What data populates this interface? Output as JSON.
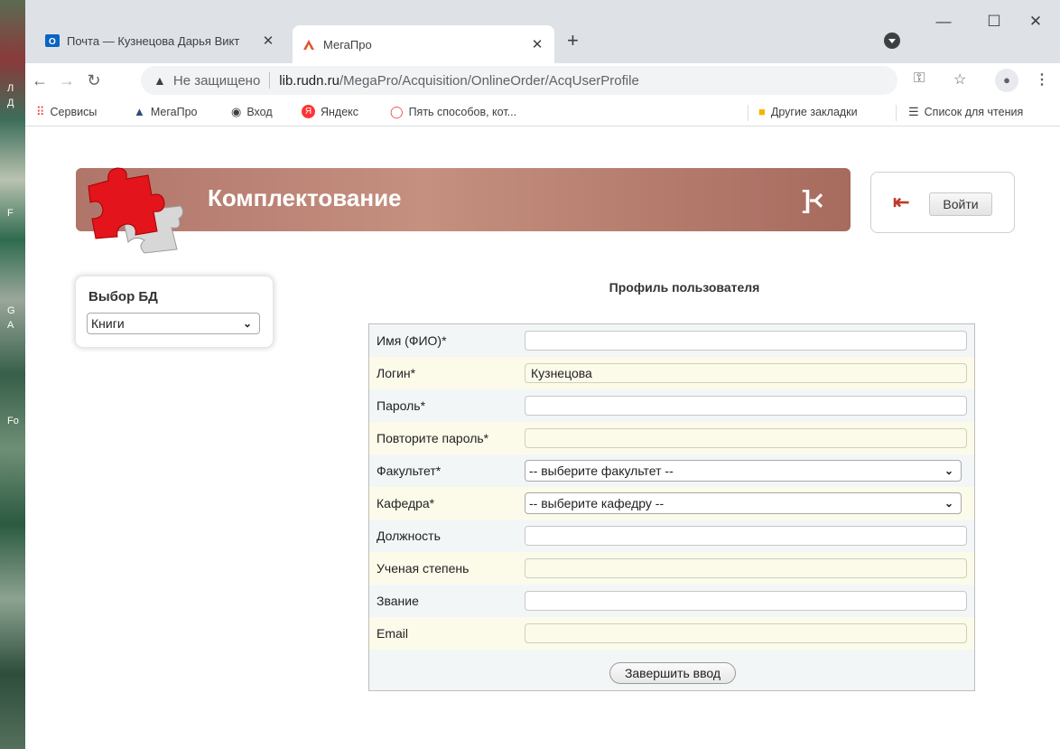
{
  "desktop": {
    "fragments": [
      "Л",
      "Д",
      "F",
      "G",
      "A",
      "Fo"
    ]
  },
  "browser": {
    "tabs": [
      {
        "title": "Почта — Кузнецова Дарья Викт",
        "active": false
      },
      {
        "title": "МегаПро",
        "active": true
      }
    ],
    "new_tab": "+",
    "window_controls": {
      "minimize": "—",
      "maximize": "☐",
      "close": "✕"
    },
    "address": {
      "security_label": "Не защищено",
      "host": "lib.rudn.ru",
      "path": "/MegaPro/Acquisition/OnlineOrder/AcqUserProfile"
    },
    "bookmarks": [
      {
        "label": "Сервисы",
        "icon": "apps-grid-icon"
      },
      {
        "label": "МегаПро",
        "icon": "megapro-icon"
      },
      {
        "label": "Вход",
        "icon": "globe-icon"
      },
      {
        "label": "Яндекс",
        "icon": "yandex-icon"
      },
      {
        "label": "Пять способов, кот...",
        "icon": "speech-bubble-icon"
      }
    ],
    "bookmarks_right": [
      {
        "label": "Другие закладки",
        "icon": "folder-icon"
      },
      {
        "label": "Список для чтения",
        "icon": "reading-list-icon"
      }
    ]
  },
  "page": {
    "banner_title": "Комплектование",
    "login_button": "Войти",
    "db_panel": {
      "label": "Выбор БД",
      "selected": "Книги"
    },
    "profile_heading": "Профиль пользователя",
    "fields": [
      {
        "label": "Имя (ФИО)*",
        "type": "text",
        "value": ""
      },
      {
        "label": "Логин*",
        "type": "text",
        "value": "Кузнецова"
      },
      {
        "label": "Пароль*",
        "type": "text",
        "value": ""
      },
      {
        "label": "Повторите пароль*",
        "type": "text",
        "value": ""
      },
      {
        "label": "Факультет*",
        "type": "select",
        "value": "-- выберите факультет --"
      },
      {
        "label": "Кафедра*",
        "type": "select",
        "value": "-- выберите кафедру --"
      },
      {
        "label": "Должность",
        "type": "text",
        "value": ""
      },
      {
        "label": "Ученая степень",
        "type": "text",
        "value": ""
      },
      {
        "label": "Звание",
        "type": "text",
        "value": ""
      },
      {
        "label": "Email",
        "type": "text",
        "value": ""
      }
    ],
    "submit_button": "Завершить ввод"
  },
  "colors": {
    "banner": "#b0756a",
    "tab_strip": "#dee1e6",
    "form_bg": "#f3f6f7",
    "alt_row": "#fcfbea",
    "puzzle_red": "#e3141b"
  }
}
